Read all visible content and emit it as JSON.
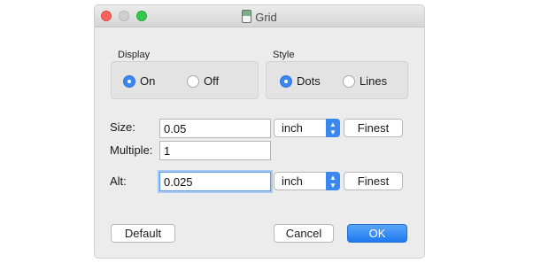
{
  "window": {
    "title": "Grid"
  },
  "display": {
    "label": "Display",
    "options": [
      {
        "label": "On",
        "checked": true
      },
      {
        "label": "Off",
        "checked": false
      }
    ]
  },
  "style": {
    "label": "Style",
    "options": [
      {
        "label": "Dots",
        "checked": true
      },
      {
        "label": "Lines",
        "checked": false
      }
    ]
  },
  "size": {
    "label": "Size:",
    "value": "0.05",
    "unit": "inch",
    "button": "Finest"
  },
  "multiple": {
    "label": "Multiple:",
    "value": "1"
  },
  "alt": {
    "label": "Alt:",
    "value": "0.025",
    "unit": "inch",
    "button": "Finest"
  },
  "buttons": {
    "default": "Default",
    "cancel": "Cancel",
    "ok": "OK"
  },
  "colors": {
    "accent": "#3b87f0"
  }
}
